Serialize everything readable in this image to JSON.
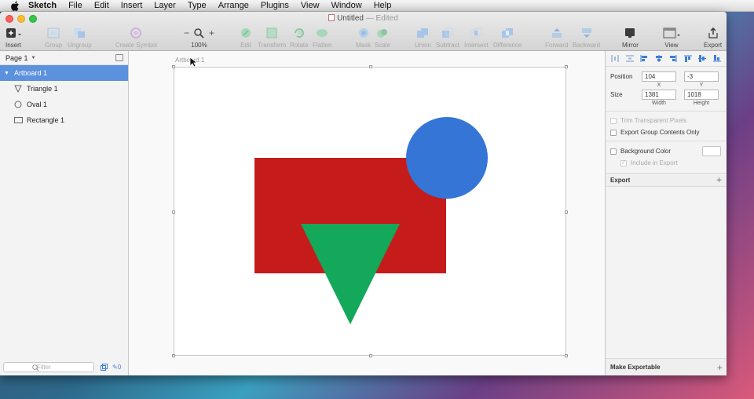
{
  "menubar": {
    "app": "Sketch",
    "items": [
      "File",
      "Edit",
      "Insert",
      "Layer",
      "Type",
      "Arrange",
      "Plugins",
      "View",
      "Window",
      "Help"
    ]
  },
  "window": {
    "title": "Untitled",
    "status": "— Edited"
  },
  "toolbar": {
    "insert": "Insert",
    "group": "Group",
    "ungroup": "Ungroup",
    "create_symbol": "Create Symbol",
    "zoom_level": "100%",
    "zoom_minus": "−",
    "zoom_plus": "+",
    "edit": "Edit",
    "transform": "Transform",
    "rotate": "Rotate",
    "flatten": "Flatten",
    "mask": "Mask",
    "scale": "Scale",
    "union": "Union",
    "subtract": "Subtract",
    "intersect": "Intersect",
    "difference": "Difference",
    "forward": "Forward",
    "backward": "Backward",
    "mirror": "Mirror",
    "view": "View",
    "export": "Export"
  },
  "layers_panel": {
    "page": "Page 1",
    "layers": [
      {
        "name": "Artboard 1",
        "icon": "disclosure-triangle-icon",
        "selected": true
      },
      {
        "name": "Triangle 1",
        "icon": "triangle-shape-icon"
      },
      {
        "name": "Oval 1",
        "icon": "oval-shape-icon"
      },
      {
        "name": "Rectangle 1",
        "icon": "rectangle-shape-icon"
      }
    ],
    "filter_placeholder": "Filter",
    "filter_count": "0"
  },
  "canvas": {
    "artboard_label": "Artboard 1",
    "colors": {
      "rectangle": "#c61b1b",
      "oval": "#3575d6",
      "triangle": "#14a85a"
    }
  },
  "inspector": {
    "position_label": "Position",
    "x_value": "104",
    "y_value": "-3",
    "x_caption": "X",
    "y_caption": "Y",
    "size_label": "Size",
    "width_value": "1381",
    "height_value": "1018",
    "width_caption": "Width",
    "height_caption": "Height",
    "trim_transparent": "Trim Transparent Pixels",
    "export_group": "Export Group Contents Only",
    "background_color": "Background Color",
    "include_in_export": "Include in Export",
    "export_section": "Export",
    "make_exportable": "Make Exportable",
    "plus": "+"
  }
}
